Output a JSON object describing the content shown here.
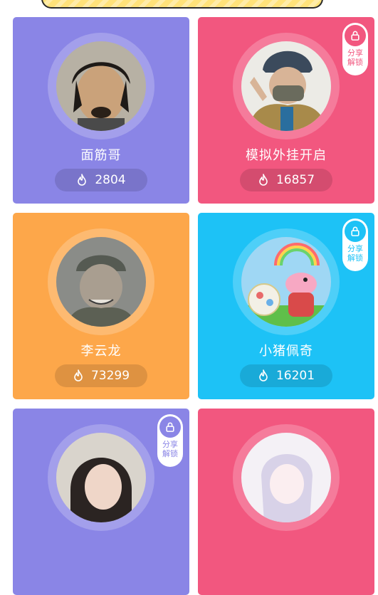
{
  "colors": {
    "purple": "#8a85e6",
    "pink": "#f2577f",
    "orange": "#fda74a",
    "blue": "#1dc2f6"
  },
  "cards": [
    {
      "name": "面筋哥",
      "count": "2804",
      "locked": false,
      "color": "#8a85e6"
    },
    {
      "name": "模拟外挂开启",
      "count": "16857",
      "locked": true,
      "lock_label": "分享解锁",
      "color": "#f2577f"
    },
    {
      "name": "李云龙",
      "count": "73299",
      "locked": false,
      "color": "#fda74a"
    },
    {
      "name": "小猪佩奇",
      "count": "16201",
      "locked": true,
      "lock_label": "分享解锁",
      "color": "#1dc2f6"
    },
    {
      "name": "",
      "count": "",
      "locked": true,
      "lock_label": "分享解锁",
      "color": "#8a85e6"
    },
    {
      "name": "",
      "count": "",
      "locked": false,
      "color": "#f2577f"
    }
  ],
  "icons": {
    "heat": "flame-icon",
    "lock": "lock-icon"
  }
}
